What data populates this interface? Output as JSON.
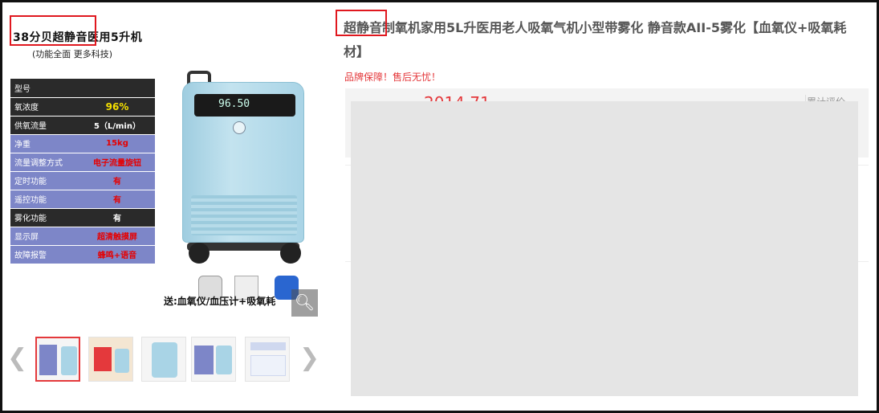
{
  "main_image": {
    "title": "38分贝超静音医用5升机",
    "subtitle": "(功能全面  更多科技)",
    "specs": [
      {
        "key": "型号",
        "value": "",
        "style": "dark"
      },
      {
        "key": "氧浓度",
        "value": "96%",
        "style": "dark-yellow"
      },
      {
        "key": "供氧流量",
        "value": "5（L/min）",
        "style": "dark"
      },
      {
        "key": "净重",
        "value": "15kg",
        "style": "light"
      },
      {
        "key": "流量调整方式",
        "value": "电子流量旋钮",
        "style": "light"
      },
      {
        "key": "定时功能",
        "value": "有",
        "style": "light"
      },
      {
        "key": "遥控功能",
        "value": "有",
        "style": "light"
      },
      {
        "key": "雾化功能",
        "value": "有",
        "style": "dark"
      },
      {
        "key": "显示屏",
        "value": "超清触摸屏",
        "style": "light"
      },
      {
        "key": "故障报警",
        "value": "蜂鸣+语音",
        "style": "light"
      }
    ],
    "display_reading": "96.50",
    "gift_label": "送:血氧仪/血压计+吸氧耗",
    "zoom_icon": "magnifier-icon"
  },
  "thumbnails": {
    "count": 5,
    "active_index": 0,
    "prev_icon": "chevron-left-icon",
    "next_icon": "chevron-right-icon"
  },
  "product": {
    "title": "超静音制氧机家用5L升医用老人吸氧气机小型带雾化 静音款AⅠⅠ-5雾化【血氧仪+吸氧耗材】",
    "slogan": "品牌保障！售后无忧！",
    "price_partial": "2014.71",
    "review_label": "累计评价"
  },
  "colors": {
    "accent_red": "#e4393c",
    "highlight_box": "#e0181f",
    "spec_dark": "#2a2a2a",
    "spec_light": "#7d86c8",
    "overlay_gray": "#e5e5e5"
  }
}
